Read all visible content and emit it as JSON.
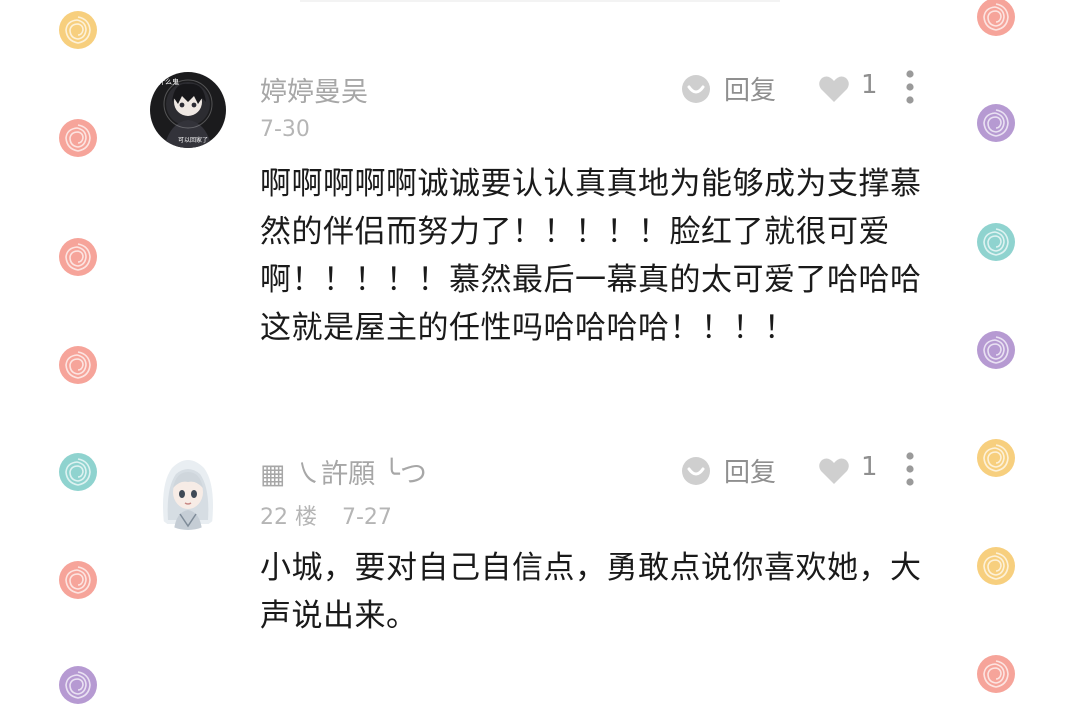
{
  "comments": [
    {
      "username": "婷婷曼吴",
      "floor": "",
      "date": "7-30",
      "reply_label": "回复",
      "like_count": "1",
      "text": "啊啊啊啊啊诚诚要认认真真地为能够成为支撑慕然的伴侣而努力了！！！！！脸红了就很可爱啊！！！！！慕然最后一幕真的太可爱了哈哈哈这就是屋主的任性吗哈哈哈哈！！！！",
      "avatar": {
        "text_top": "什么鬼",
        "text_bottom": "可以回家了"
      }
    },
    {
      "username": "▦ ㇏許願 ╰つ",
      "floor": "22 楼",
      "date": "7-27",
      "reply_label": "回复",
      "like_count": "1",
      "text": "小城，要对自己自信点，勇敢点说你喜欢她，大声说出来。"
    }
  ],
  "decor": {
    "colors": [
      "#f7cf7e",
      "#f6a49a",
      "#8fd3cf",
      "#b69ad2"
    ]
  }
}
